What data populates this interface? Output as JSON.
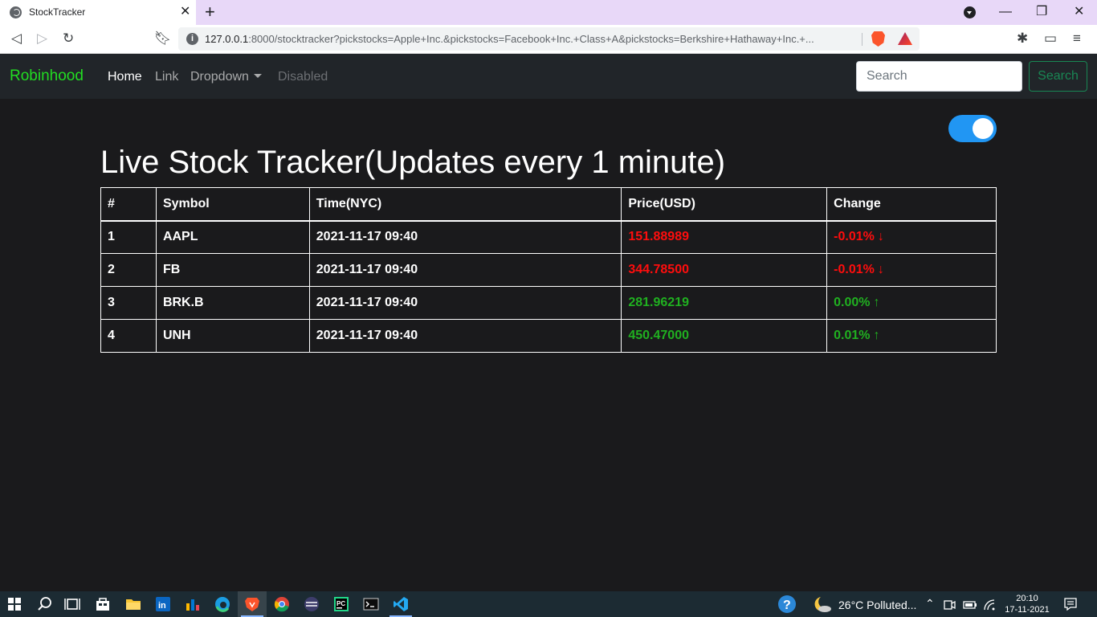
{
  "browser": {
    "tab_title": "StockTracker",
    "url_host": "127.0.0.1",
    "url_rest": ":8000/stocktracker?pickstocks=Apple+Inc.&pickstocks=Facebook+Inc.+Class+A&pickstocks=Berkshire+Hathaway+Inc.+...",
    "info_icon": "i"
  },
  "navbar": {
    "brand": "Robinhood",
    "links": [
      {
        "label": "Home",
        "state": "active"
      },
      {
        "label": "Link",
        "state": "normal"
      },
      {
        "label": "Dropdown",
        "state": "normal"
      },
      {
        "label": "Disabled",
        "state": "disabled"
      }
    ],
    "search_placeholder": "Search",
    "search_button": "Search",
    "brand_color": "#22dd22",
    "search_button_color": "#198754"
  },
  "main": {
    "title": "Live Stock Tracker(Updates every 1 minute)",
    "toggle_on": true,
    "toggle_color": "#2196f3",
    "table": {
      "headers": [
        "#",
        "Symbol",
        "Time(NYC)",
        "Price(USD)",
        "Change"
      ],
      "rows": [
        {
          "num": "1",
          "symbol": "AAPL",
          "time": "2021-11-17 09:40",
          "price": "151.88989",
          "change": "-0.01%",
          "arrow": "↓",
          "direction": "down"
        },
        {
          "num": "2",
          "symbol": "FB",
          "time": "2021-11-17 09:40",
          "price": "344.78500",
          "change": "-0.01%",
          "arrow": "↓",
          "direction": "down"
        },
        {
          "num": "3",
          "symbol": "BRK.B",
          "time": "2021-11-17 09:40",
          "price": "281.96219",
          "change": "0.00%",
          "arrow": "↑",
          "direction": "up"
        },
        {
          "num": "4",
          "symbol": "UNH",
          "time": "2021-11-17 09:40",
          "price": "450.47000",
          "change": "0.01%",
          "arrow": "↑",
          "direction": "up"
        }
      ],
      "down_color": "#ff0d0d",
      "up_color": "#20b020"
    }
  },
  "taskbar": {
    "weather": "26°C  Polluted...",
    "time": "20:10",
    "date": "17-11-2021"
  }
}
